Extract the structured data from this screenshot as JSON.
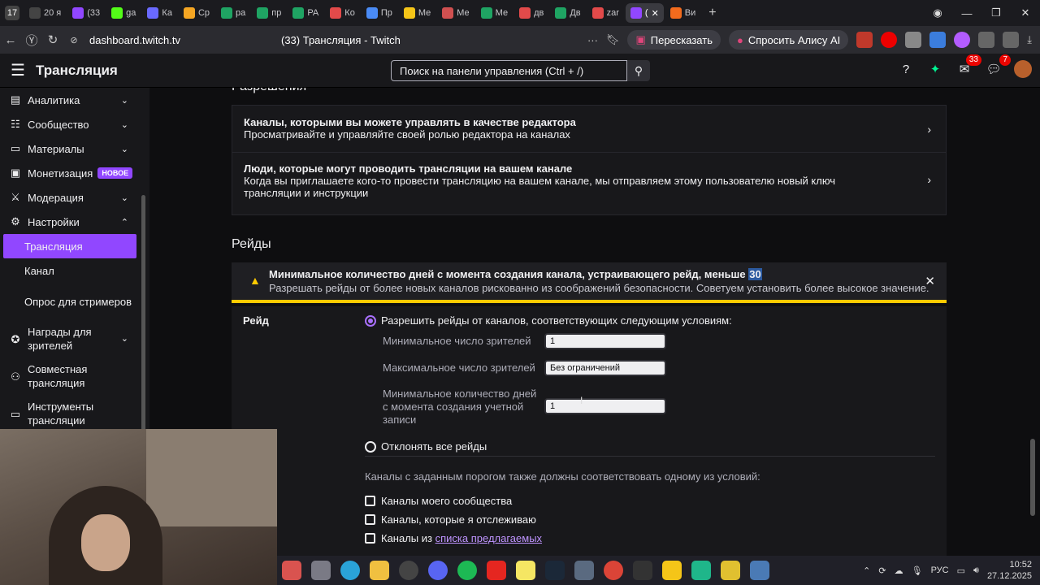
{
  "browser": {
    "tab_count_badge": "17",
    "tabs": [
      {
        "label": "20 я",
        "color": "#444444",
        "active": false
      },
      {
        "label": "(33",
        "color": "#9147ff",
        "active": false
      },
      {
        "label": "ga",
        "color": "#53fc18",
        "active": false
      },
      {
        "label": "Ка",
        "color": "#6a6aff",
        "active": false
      },
      {
        "label": "Ср",
        "color": "#f5a623",
        "active": false
      },
      {
        "label": "ра",
        "color": "#1fa463",
        "active": false
      },
      {
        "label": "пр",
        "color": "#1fa463",
        "active": false
      },
      {
        "label": "РА",
        "color": "#1fa463",
        "active": false
      },
      {
        "label": "Ко",
        "color": "#e24a4a",
        "active": false
      },
      {
        "label": "Пр",
        "color": "#4a8bf5",
        "active": false
      },
      {
        "label": "Ме",
        "color": "#f5c518",
        "active": false
      },
      {
        "label": "Ме",
        "color": "#d05050",
        "active": false
      },
      {
        "label": "Ме",
        "color": "#1fa463",
        "active": false
      },
      {
        "label": "дв",
        "color": "#e24a4a",
        "active": false
      },
      {
        "label": "Дв",
        "color": "#1fa463",
        "active": false
      },
      {
        "label": "zar",
        "color": "#e24a4a",
        "active": false
      },
      {
        "label": "(",
        "color": "#9147ff",
        "active": true
      },
      {
        "label": "Ви",
        "color": "#f26b1d",
        "active": false
      }
    ],
    "url": "dashboard.twitch.tv",
    "page_title": "(33) Трансляция - Twitch",
    "retell_label": "Пересказать",
    "alice_label": "Спросить Алису AI"
  },
  "topnav": {
    "title": "Трансляция",
    "search_placeholder": "Поиск на панели управления (Ctrl + /)",
    "inbox_badge": "33",
    "notif_badge": "7"
  },
  "sidebar": {
    "items": [
      {
        "label": "Аналитика",
        "icon": "chart-icon"
      },
      {
        "label": "Сообщество",
        "icon": "community-icon"
      },
      {
        "label": "Материалы",
        "icon": "content-icon"
      },
      {
        "label": "Монетизация",
        "icon": "monetization-icon",
        "badge": "НОВОЕ"
      },
      {
        "label": "Модерация",
        "icon": "moderation-icon"
      },
      {
        "label": "Настройки",
        "icon": "settings-icon"
      }
    ],
    "settings_sub": [
      "Трансляция",
      "Канал",
      "Опрос для стримеров"
    ],
    "items_after": [
      {
        "label": "Награды для зрителей",
        "icon": "rewards-icon"
      },
      {
        "label": "Совместная трансляция",
        "icon": "collab-icon"
      },
      {
        "label": "Инструменты трансляции",
        "icon": "tools-icon"
      }
    ]
  },
  "main": {
    "permissions_heading": "Разрешения",
    "perm_rows": [
      {
        "title": "Каналы, которыми вы можете управлять в качестве редактора",
        "desc": "Просматривайте и управляйте своей ролью редактора на каналах"
      },
      {
        "title": "Люди, которые могут проводить трансляции на вашем канале",
        "desc": "Когда вы приглашаете кого-то провести трансляцию на вашем канале, мы отправляем этому пользователю новый ключ трансляции и инструкции"
      }
    ],
    "raids_heading": "Рейды",
    "warning": {
      "title": "Минимальное количество дней с момента создания канала, устраивающего рейд, меньше",
      "value": "30",
      "desc": "Разрешать рейды от более новых каналов рискованно из соображений безопасности. Советуем установить более высокое значение."
    },
    "raid": {
      "label": "Рейд",
      "allow_label": "Разрешить рейды от каналов, соответствующих следующим условиям:",
      "min_viewers_label": "Минимальное число зрителей",
      "min_viewers_value": "1",
      "max_viewers_label": "Максимальное число зрителей",
      "max_viewers_value": "Без ограничений",
      "min_days_label": "Минимальное количество дней с момента создания учетной записи",
      "min_days_value": "1",
      "reject_label": "Отклонять все рейды",
      "conditions_text": "Каналы с заданным порогом также должны соответствовать одному из условий:",
      "cb_community": "Каналы моего сообщества",
      "cb_following": "Каналы, которые я отслеживаю",
      "cb_from": "Каналы из",
      "cb_link": "списка предлагаемых"
    }
  },
  "taskbar": {
    "lang": "РУС",
    "time": "10:52",
    "date": "27.12.2025"
  }
}
